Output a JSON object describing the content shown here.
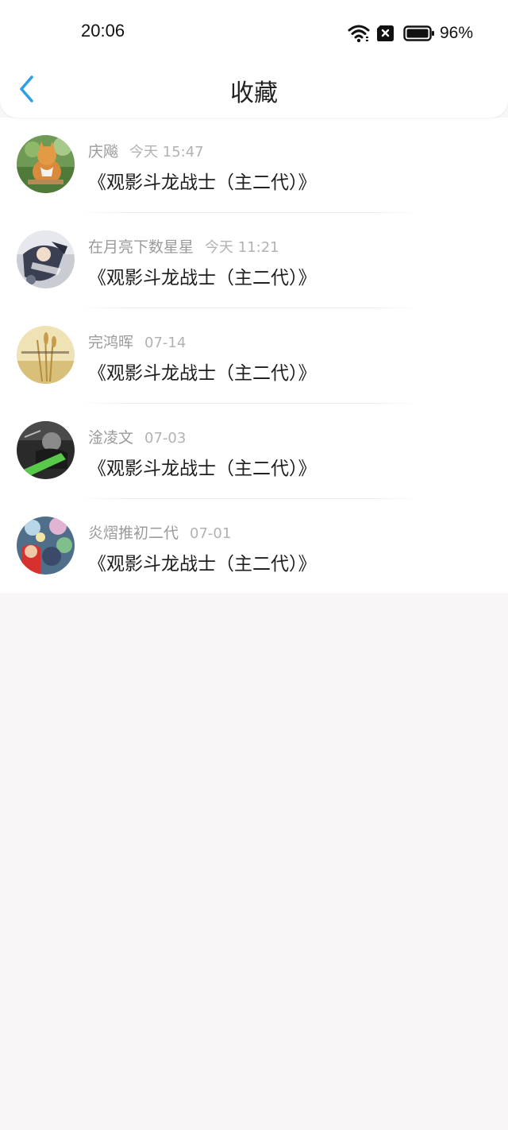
{
  "status_bar": {
    "time": "20:06",
    "battery_percent": "96%",
    "icons": [
      "wifi-icon",
      "sim-x-icon",
      "battery-icon"
    ]
  },
  "header": {
    "title": "收藏",
    "back_icon": "chevron-left-icon",
    "accent_color": "#2fa0e3"
  },
  "favorites": [
    {
      "author": "庆飚",
      "time": "今天 15:47",
      "title": "《观影斗龙战士（主二代）》",
      "avatar_icon": "avatar-cat"
    },
    {
      "author": "在月亮下数星星",
      "time": "今天 11:21",
      "title": "《观影斗龙战士（主二代）》",
      "avatar_icon": "avatar-anime-dark"
    },
    {
      "author": "完鸿晖",
      "time": "07-14",
      "title": "《观影斗龙战士（主二代）》",
      "avatar_icon": "avatar-wheat"
    },
    {
      "author": "淦凌文",
      "time": "07-03",
      "title": "《观影斗龙战士（主二代）》",
      "avatar_icon": "avatar-mono-green"
    },
    {
      "author": "炎熠推初二代",
      "time": "07-01",
      "title": "《观影斗龙战士（主二代）》",
      "avatar_icon": "avatar-colorful"
    }
  ]
}
